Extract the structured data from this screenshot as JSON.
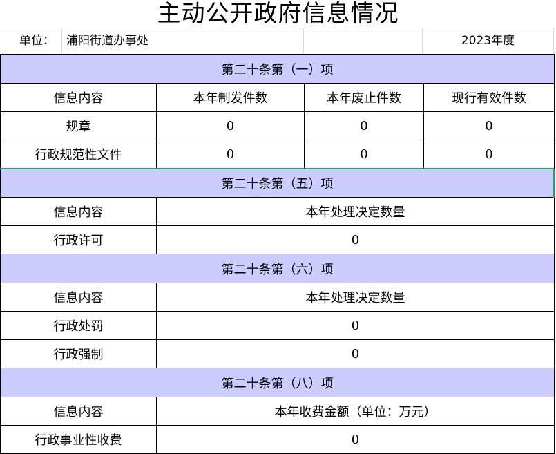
{
  "title": "主动公开政府信息情况",
  "unit": {
    "label": "单位：",
    "name": "浦阳街道办事处",
    "year": "2023年度"
  },
  "sections": [
    {
      "heading": "第二十条第（一）项",
      "header": [
        "信息内容",
        "本年制发件数",
        "本年废止件数",
        "现行有效件数"
      ],
      "rows": [
        [
          "规章",
          "0",
          "0",
          "0"
        ],
        [
          "行政规范性文件",
          "0",
          "0",
          "0"
        ]
      ]
    },
    {
      "heading": "第二十条第（五）项",
      "header": [
        "信息内容",
        "本年处理决定数量"
      ],
      "rows": [
        [
          "行政许可",
          "0"
        ]
      ]
    },
    {
      "heading": "第二十条第（六）项",
      "header": [
        "信息内容",
        "本年处理决定数量"
      ],
      "rows": [
        [
          "行政处罚",
          "0"
        ],
        [
          "行政强制",
          "0"
        ]
      ]
    },
    {
      "heading": "第二十条第（八）项",
      "header": [
        "信息内容",
        "本年收费金额（单位：万元）"
      ],
      "rows": [
        [
          "行政事业性收费",
          "0"
        ]
      ]
    }
  ]
}
